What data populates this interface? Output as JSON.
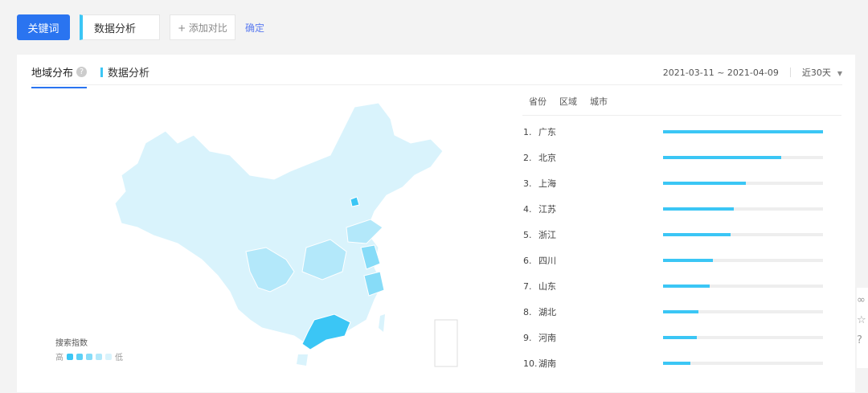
{
  "toolbar": {
    "keyword_button": "关键词",
    "keyword_value": "数据分析",
    "add_compare": "+ 添加对比",
    "confirm": "确定"
  },
  "panel": {
    "tab": "地域分布",
    "help": "?",
    "series_name": "数据分析",
    "date_range": "2021-03-11 ~ 2021-04-09",
    "period": "近30天"
  },
  "legend": {
    "title": "搜索指数",
    "high": "高",
    "low": "低",
    "colors": [
      "#3bc6f5",
      "#5cd0f6",
      "#87dcf8",
      "#b3e8fa",
      "#d9f3fc"
    ]
  },
  "subtabs": [
    "省份",
    "区域",
    "城市"
  ],
  "ranking": [
    {
      "rank": "1.",
      "name": "广东",
      "value": 100
    },
    {
      "rank": "2.",
      "name": "北京",
      "value": 74
    },
    {
      "rank": "3.",
      "name": "上海",
      "value": 52
    },
    {
      "rank": "4.",
      "name": "江苏",
      "value": 44
    },
    {
      "rank": "5.",
      "name": "浙江",
      "value": 42
    },
    {
      "rank": "6.",
      "name": "四川",
      "value": 31
    },
    {
      "rank": "7.",
      "name": "山东",
      "value": 29
    },
    {
      "rank": "8.",
      "name": "湖北",
      "value": 22
    },
    {
      "rank": "9.",
      "name": "河南",
      "value": 21
    },
    {
      "rank": "10.",
      "name": "湖南",
      "value": 17
    }
  ]
}
